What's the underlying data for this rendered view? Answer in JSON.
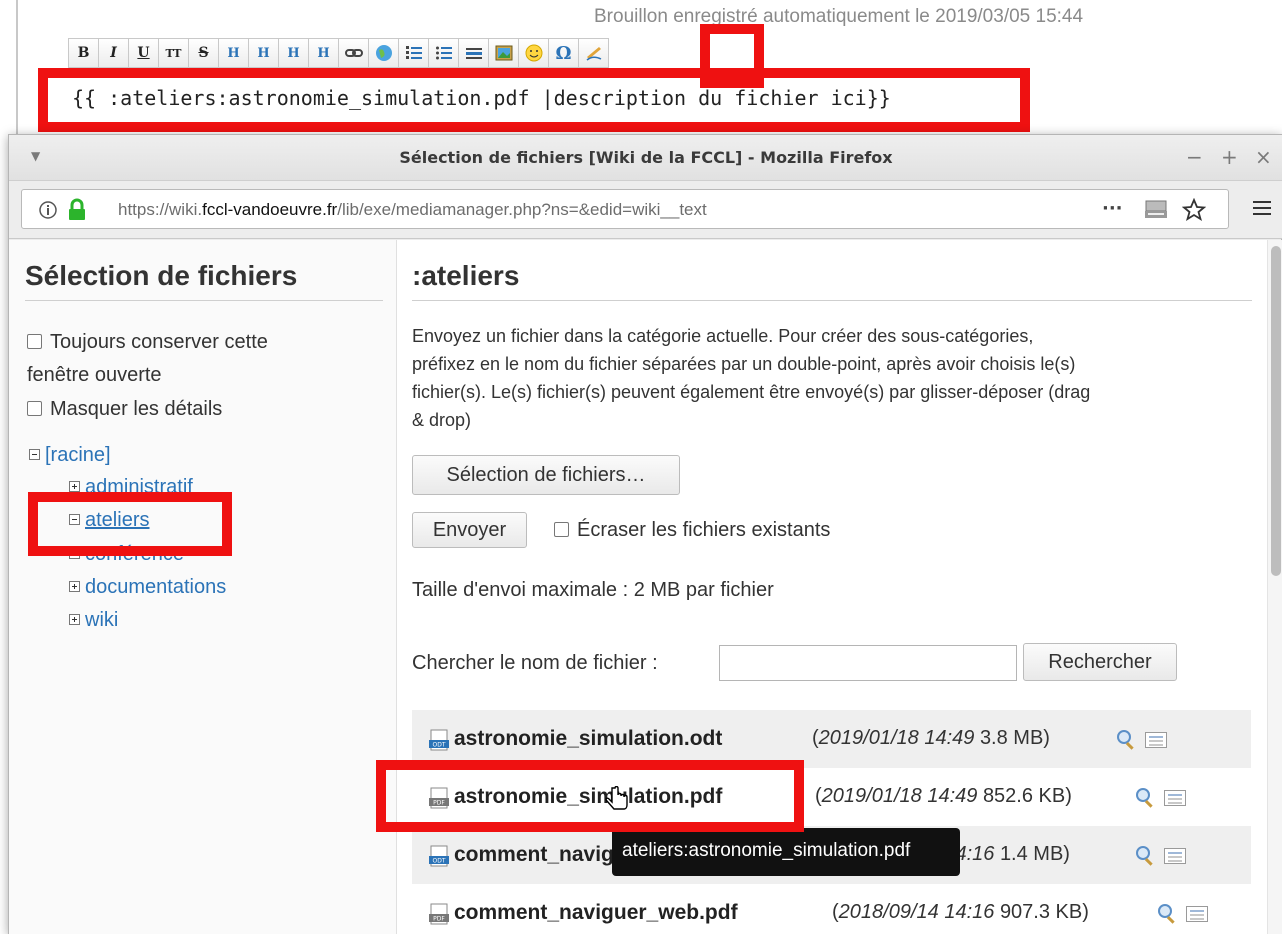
{
  "editor": {
    "autosave_text": "Brouillon enregistré automatiquement le 2019/03/05 15:44",
    "toolbar": [
      "B",
      "I",
      "U",
      "TT",
      "S",
      "H",
      "H",
      "H",
      "H",
      "link",
      "extlink",
      "ol",
      "ul",
      "hr",
      "image",
      "smiley",
      "Ω",
      "sig"
    ],
    "content": "{{ :ateliers:astronomie_simulation.pdf |description du fichier ici}}"
  },
  "window": {
    "title": "Sélection de fichiers [Wiki de la FCCL] - Mozilla Firefox",
    "url_prefix": "https://wiki.",
    "url_domain": "fccl-vandoeuvre.fr",
    "url_path": "/lib/exe/mediamanager.php?ns=&edid=wiki__text",
    "controls": [
      "−",
      "+",
      "×"
    ]
  },
  "sidebar": {
    "title": "Sélection de fichiers",
    "opt_keep_open_line1": "Toujours conserver cette",
    "opt_keep_open_line2": "fenêtre ouverte",
    "opt_hide_details": "Masquer les détails",
    "tree": [
      {
        "label": "[racine]",
        "expanded": true
      },
      {
        "label": "administratif",
        "expanded": false
      },
      {
        "label": "ateliers",
        "expanded": true
      },
      {
        "label": "conférence",
        "expanded": false
      },
      {
        "label": "documentations",
        "expanded": false
      },
      {
        "label": "wiki",
        "expanded": false
      }
    ]
  },
  "main": {
    "title": ":ateliers",
    "help_lines": [
      "Envoyez un fichier dans la catégorie actuelle. Pour créer des sous-catégories,",
      "préfixez en le nom du fichier séparées par un double-point, après avoir choisis le(s)",
      "fichier(s). Le(s) fichier(s) peuvent également être envoyé(s) par glisser-déposer (drag",
      "& drop)"
    ],
    "select_files_button": "Sélection de fichiers…",
    "send_button": "Envoyer",
    "overwrite_label": "Écraser les fichiers existants",
    "max_size_text": "Taille d'envoi maximale : 2 MB par fichier",
    "search_label": "Chercher le nom de fichier :",
    "search_value": "",
    "search_button": "Rechercher",
    "files": [
      {
        "name": "astronomie_simulation.odt",
        "date": "2019/01/18 14:49",
        "size": "3.8 MB",
        "icon": "odt-icon"
      },
      {
        "name": "astronomie_simulation.pdf",
        "date": "2019/01/18 14:49",
        "size": "852.6 KB",
        "icon": "pdf-icon"
      },
      {
        "name": "comment_naviguer_web.odt",
        "date": "2018/09/14 14:16",
        "size": "1.4 MB",
        "icon": "odt-icon"
      },
      {
        "name": "comment_naviguer_web.pdf",
        "date": "2018/09/14 14:16",
        "size": "907.3 KB",
        "icon": "pdf-icon"
      }
    ],
    "tooltip": "ateliers:astronomie_simulation.pdf"
  },
  "colors": {
    "highlight_red": "#ef1111",
    "link_blue": "#2b73b7",
    "lock_green": "#2cb42c"
  }
}
